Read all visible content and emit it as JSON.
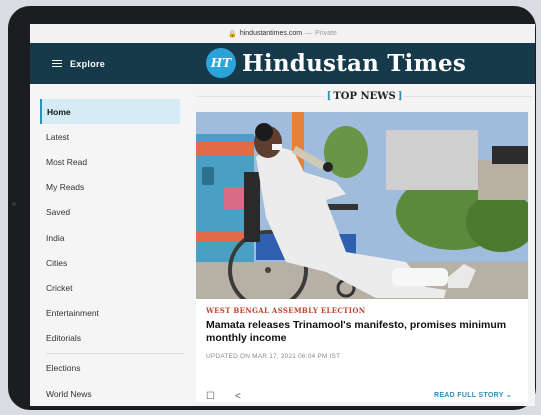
{
  "browser": {
    "url": "hindustantimes.com",
    "separator": "—",
    "mode": "Private"
  },
  "header": {
    "explore_label": "Explore",
    "logo_mark": "HT",
    "logo_text": "Hindustan Times"
  },
  "sidebar": {
    "items": [
      {
        "label": "Home"
      },
      {
        "label": "Latest"
      },
      {
        "label": "Most Read"
      },
      {
        "label": "My Reads"
      },
      {
        "label": "Saved"
      },
      {
        "label": "India"
      },
      {
        "label": "Cities"
      },
      {
        "label": "Cricket"
      },
      {
        "label": "Entertainment"
      },
      {
        "label": "Editorials"
      },
      {
        "label": "Elections"
      },
      {
        "label": "World News"
      }
    ]
  },
  "main": {
    "section_title": "TOP NEWS",
    "story": {
      "kicker": "WEST BENGAL ASSEMBLY ELECTION",
      "headline": "Mamata releases Trinamool's manifesto, promises minimum monthly income",
      "meta": "UPDATED ON MAR 17, 2021 06:04 PM IST",
      "read_more": "READ FULL STORY"
    }
  },
  "colors": {
    "header_bg": "#173a4b",
    "accent": "#2c8fbd",
    "kicker": "#c4412e",
    "active_nav_bg": "#d5ecf7"
  }
}
